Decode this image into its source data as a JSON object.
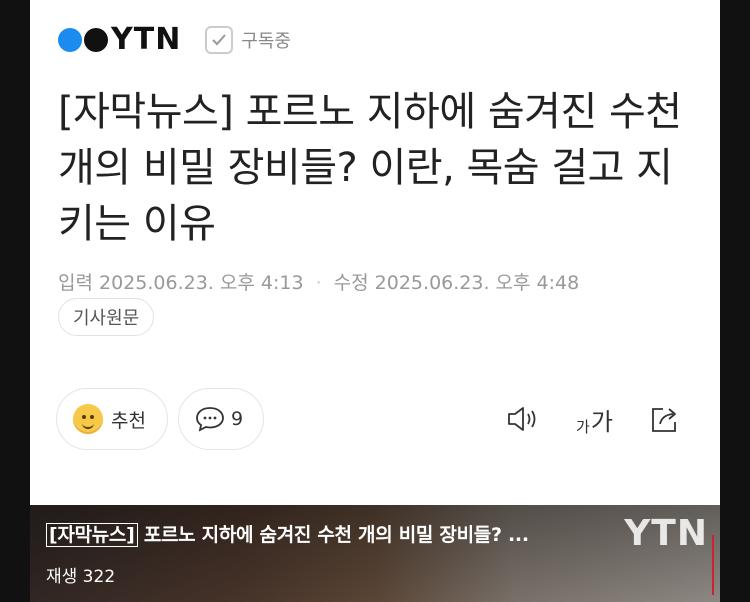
{
  "brand": {
    "logo_text": "YTN",
    "subscribe_label": "구독중"
  },
  "article": {
    "headline": "[자막뉴스] 포르노 지하에 숨겨진 수천 개의 비밀 장비들? 이란, 목숨 걸고 지키는 이유",
    "published": "입력 2025.06.23. 오후 4:13",
    "modified": "수정 2025.06.23. 오후 4:48",
    "source_label": "기사원문"
  },
  "actions": {
    "recommend_label": "추천",
    "comment_count": "9",
    "fontsize_small": "가",
    "fontsize_large": "가"
  },
  "video": {
    "tag": "[자막뉴스]",
    "title_rest": " 포르노 지하에 숨겨진 수천 개의 비밀 장비들? ...",
    "plays": "재생 322",
    "overlay_logo": "YTN"
  },
  "icons": {
    "subscribed": "check-icon",
    "recommend": "smile-emoji-icon",
    "comment": "speech-bubble-icon",
    "audio": "speaker-icon",
    "share": "share-icon"
  },
  "colors": {
    "logo_dot": "#1a8cf0",
    "text": "#222222",
    "meta": "#999999"
  }
}
